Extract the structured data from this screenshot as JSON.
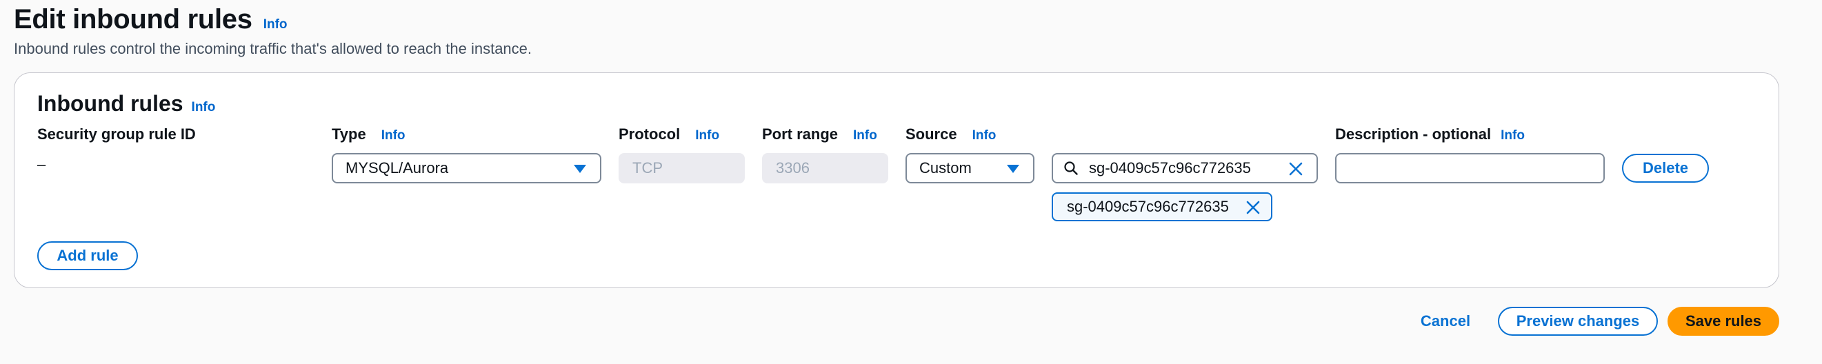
{
  "header": {
    "title": "Edit inbound rules",
    "info": "Info",
    "description": "Inbound rules control the incoming traffic that's allowed to reach the instance."
  },
  "panel": {
    "title": "Inbound rules",
    "info": "Info",
    "columns": {
      "rule_id": "Security group rule ID",
      "type": "Type",
      "protocol": "Protocol",
      "port_range": "Port range",
      "source": "Source",
      "description": "Description - optional",
      "info": "Info"
    },
    "rule": {
      "rule_id": "–",
      "type": "MYSQL/Aurora",
      "protocol": "TCP",
      "port_range": "3306",
      "source": "Custom",
      "source_search": "sg-0409c57c96c772635",
      "token": "sg-0409c57c96c772635",
      "description": "",
      "delete_label": "Delete"
    },
    "add_rule_label": "Add rule"
  },
  "footer": {
    "cancel_label": "Cancel",
    "preview_label": "Preview changes",
    "save_label": "Save rules"
  },
  "colors": {
    "accent": "#0972d3",
    "primary_button": "#ff9900",
    "border": "#7d8998"
  },
  "icons": {
    "caret": "caret-down-icon",
    "search": "search-icon",
    "clear": "close-icon"
  }
}
